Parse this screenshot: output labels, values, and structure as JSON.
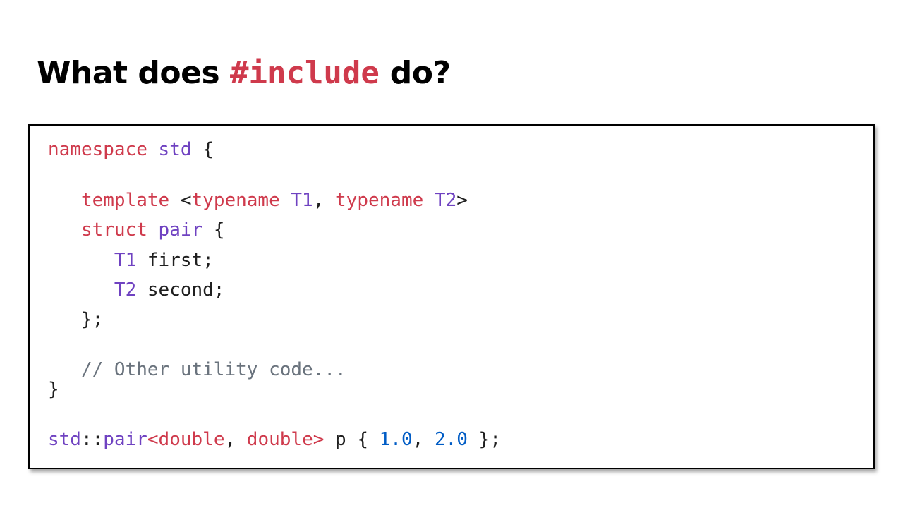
{
  "colors": {
    "keyword": "#cf3a4c",
    "type": "#6f42c1",
    "plain": "#1f1f1f",
    "comment": "#6a737d",
    "number": "#005cc5",
    "title": "#000000"
  },
  "title": {
    "before": "What does ",
    "keyword": "#include",
    "after": " do?"
  },
  "code_lines": [
    [
      {
        "t": "namespace",
        "c": "keyword"
      },
      {
        "t": " ",
        "c": "plain"
      },
      {
        "t": "std",
        "c": "type"
      },
      {
        "t": " {",
        "c": "plain"
      }
    ],
    [
      {
        "t": "   ",
        "c": "plain"
      },
      {
        "t": "template",
        "c": "keyword"
      },
      {
        "t": " <",
        "c": "plain"
      },
      {
        "t": "typename",
        "c": "keyword"
      },
      {
        "t": " ",
        "c": "plain"
      },
      {
        "t": "T1",
        "c": "type"
      },
      {
        "t": ", ",
        "c": "plain"
      },
      {
        "t": "typename",
        "c": "keyword"
      },
      {
        "t": " ",
        "c": "plain"
      },
      {
        "t": "T2",
        "c": "type"
      },
      {
        "t": ">",
        "c": "plain"
      }
    ],
    [
      {
        "t": "   ",
        "c": "plain"
      },
      {
        "t": "struct",
        "c": "keyword"
      },
      {
        "t": " ",
        "c": "plain"
      },
      {
        "t": "pair",
        "c": "type"
      },
      {
        "t": " {",
        "c": "plain"
      }
    ],
    [
      {
        "t": "      ",
        "c": "plain"
      },
      {
        "t": "T1",
        "c": "type"
      },
      {
        "t": " first;",
        "c": "plain"
      }
    ],
    [
      {
        "t": "      ",
        "c": "plain"
      },
      {
        "t": "T2",
        "c": "type"
      },
      {
        "t": " second;",
        "c": "plain"
      }
    ],
    [
      {
        "t": "   };",
        "c": "plain"
      }
    ],
    [
      {
        "t": "   // Other utility code...",
        "c": "comment"
      }
    ],
    [
      {
        "t": "}",
        "c": "plain"
      }
    ],
    [
      {
        "t": "std",
        "c": "type"
      },
      {
        "t": "::",
        "c": "plain"
      },
      {
        "t": "pair",
        "c": "type"
      },
      {
        "t": "<double",
        "c": "keyword"
      },
      {
        "t": ", ",
        "c": "plain"
      },
      {
        "t": "double>",
        "c": "keyword"
      },
      {
        "t": " p { ",
        "c": "plain"
      },
      {
        "t": "1.0",
        "c": "number"
      },
      {
        "t": ", ",
        "c": "plain"
      },
      {
        "t": "2.0",
        "c": "number"
      },
      {
        "t": " };",
        "c": "plain"
      }
    ]
  ]
}
